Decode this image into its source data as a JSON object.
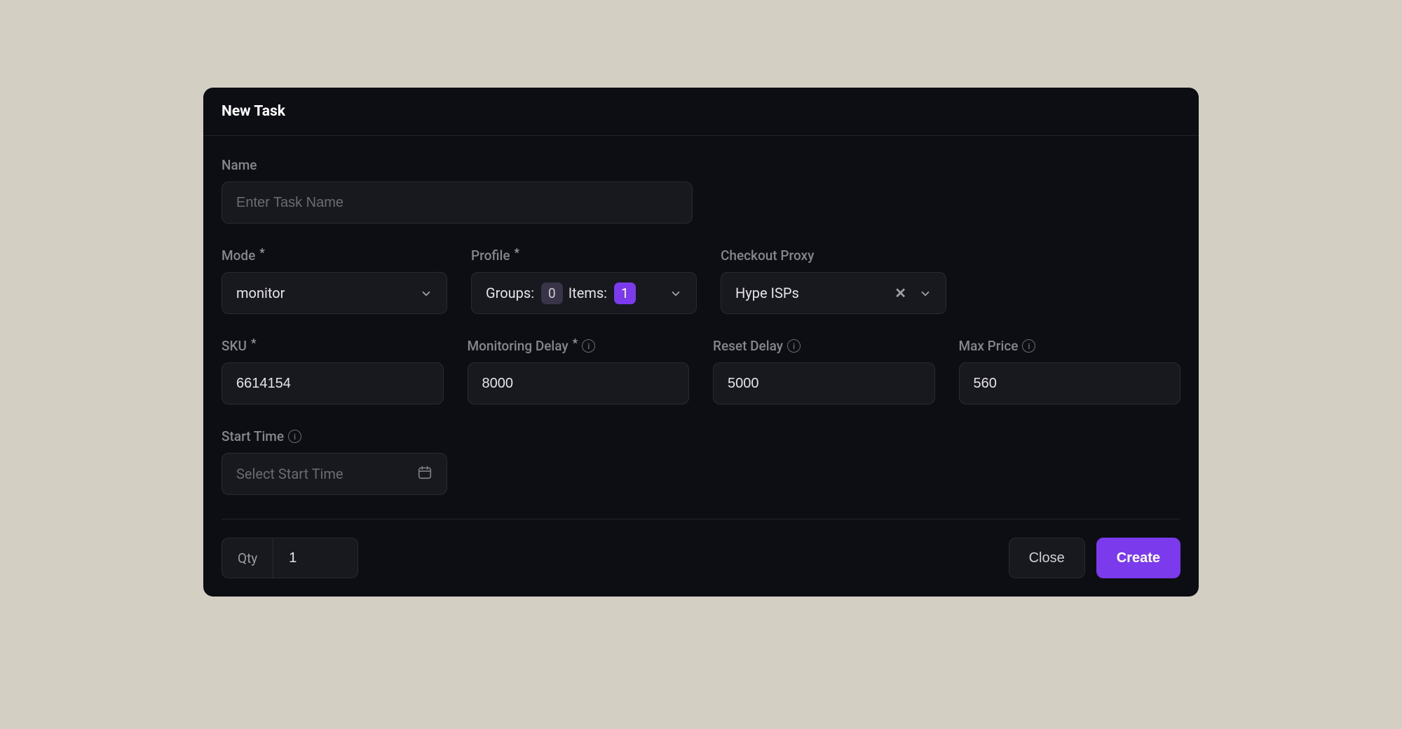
{
  "modal": {
    "title": "New Task"
  },
  "fields": {
    "name": {
      "label": "Name",
      "placeholder": "Enter Task Name",
      "value": ""
    },
    "mode": {
      "label": "Mode",
      "value": "monitor"
    },
    "profile": {
      "label": "Profile",
      "groups_label": "Groups:",
      "groups_count": "0",
      "items_label": "Items:",
      "items_count": "1"
    },
    "checkout_proxy": {
      "label": "Checkout Proxy",
      "value": "Hype ISPs"
    },
    "sku": {
      "label": "SKU",
      "value": "6614154"
    },
    "monitoring_delay": {
      "label": "Monitoring Delay",
      "value": "8000"
    },
    "reset_delay": {
      "label": "Reset Delay",
      "value": "5000"
    },
    "max_price": {
      "label": "Max Price",
      "value": "560"
    },
    "start_time": {
      "label": "Start Time",
      "placeholder": "Select Start Time",
      "value": ""
    }
  },
  "footer": {
    "qty_label": "Qty",
    "qty_value": "1",
    "close": "Close",
    "create": "Create"
  }
}
